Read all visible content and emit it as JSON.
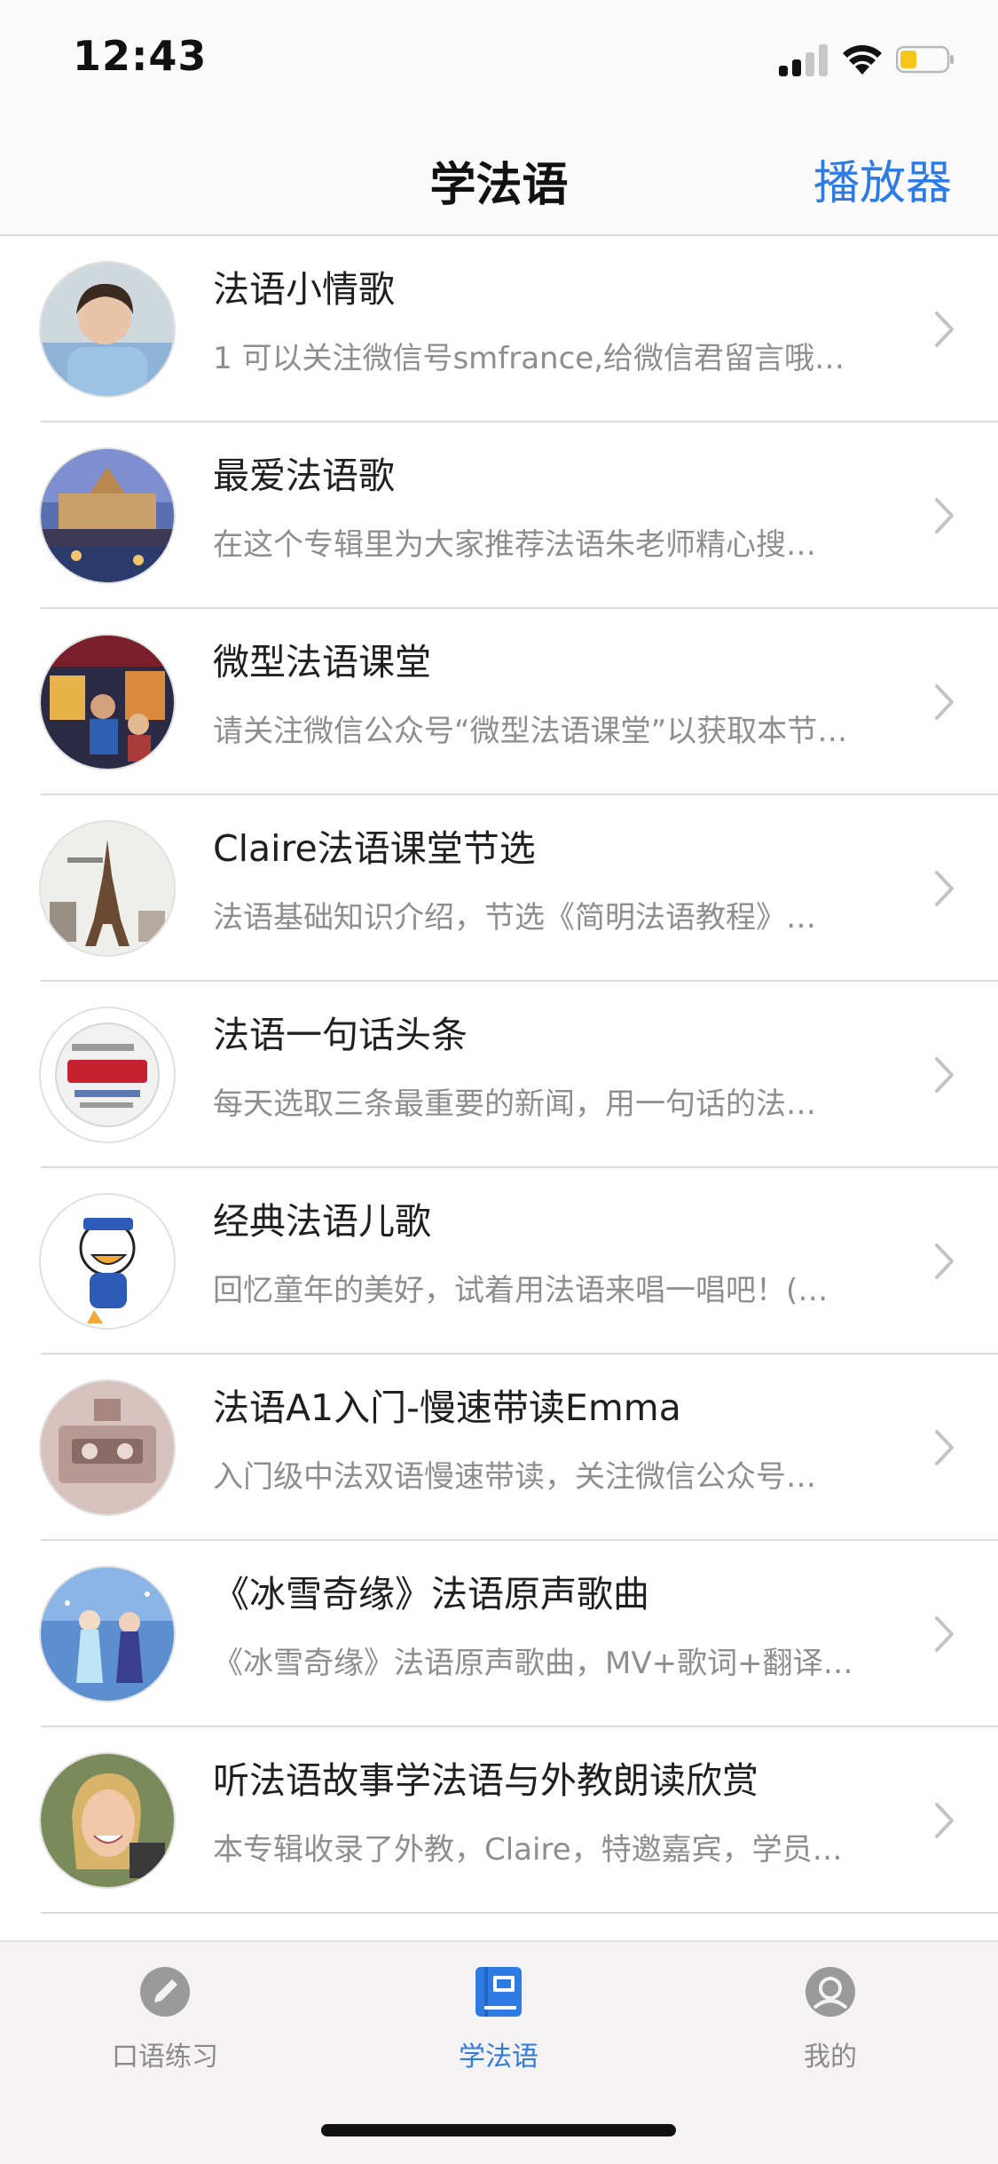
{
  "status_bar": {
    "time": "12:43"
  },
  "nav": {
    "title": "学法语",
    "action": "播放器"
  },
  "list": [
    {
      "title": "法语小情歌",
      "subtitle": "1 可以关注微信号smfrance,给微信君留言哦…",
      "avatar_icon": "portrait-photo"
    },
    {
      "title": "最爱法语歌",
      "subtitle": "在这个专辑里为大家推荐法语朱老师精心搜…",
      "avatar_icon": "paris-bridge-photo"
    },
    {
      "title": "微型法语课堂",
      "subtitle": "请关注微信公众号“微型法语课堂”以获取本节…",
      "avatar_icon": "cafe-painting-photo"
    },
    {
      "title": "Claire法语课堂节选",
      "subtitle": "法语基础知识介绍，节选《简明法语教程》…",
      "avatar_icon": "eiffel-tower-photo"
    },
    {
      "title": "法语一句话头条",
      "subtitle": "每天选取三条最重要的新闻，用一句话的法…",
      "avatar_icon": "news-word-ball"
    },
    {
      "title": "经典法语儿歌",
      "subtitle": "回忆童年的美好，试着用法语来唱一唱吧！(…",
      "avatar_icon": "cartoon-duck"
    },
    {
      "title": "法语A1入门-慢速带读Emma",
      "subtitle": "入门级中法双语慢速带读，关注微信公众号…",
      "avatar_icon": "cassette-photo"
    },
    {
      "title": "《冰雪奇缘》法语原声歌曲",
      "subtitle": "《冰雪奇缘》法语原声歌曲，MV+歌词+翻译…",
      "avatar_icon": "frozen-photo"
    },
    {
      "title": "听法语故事学法语与外教朗读欣赏",
      "subtitle": "本专辑收录了外教，Claire，特邀嘉宾，学员…",
      "avatar_icon": "smiling-woman-photo"
    }
  ],
  "tabs": [
    {
      "label": "口语练习",
      "icon": "pencil-icon",
      "active": false
    },
    {
      "label": "学法语",
      "icon": "book-icon",
      "active": true
    },
    {
      "label": "我的",
      "icon": "profile-icon",
      "active": false
    }
  ],
  "colors": {
    "accent": "#2f7be4",
    "inactive": "#8a8a8a",
    "battery": "#f5c518"
  }
}
